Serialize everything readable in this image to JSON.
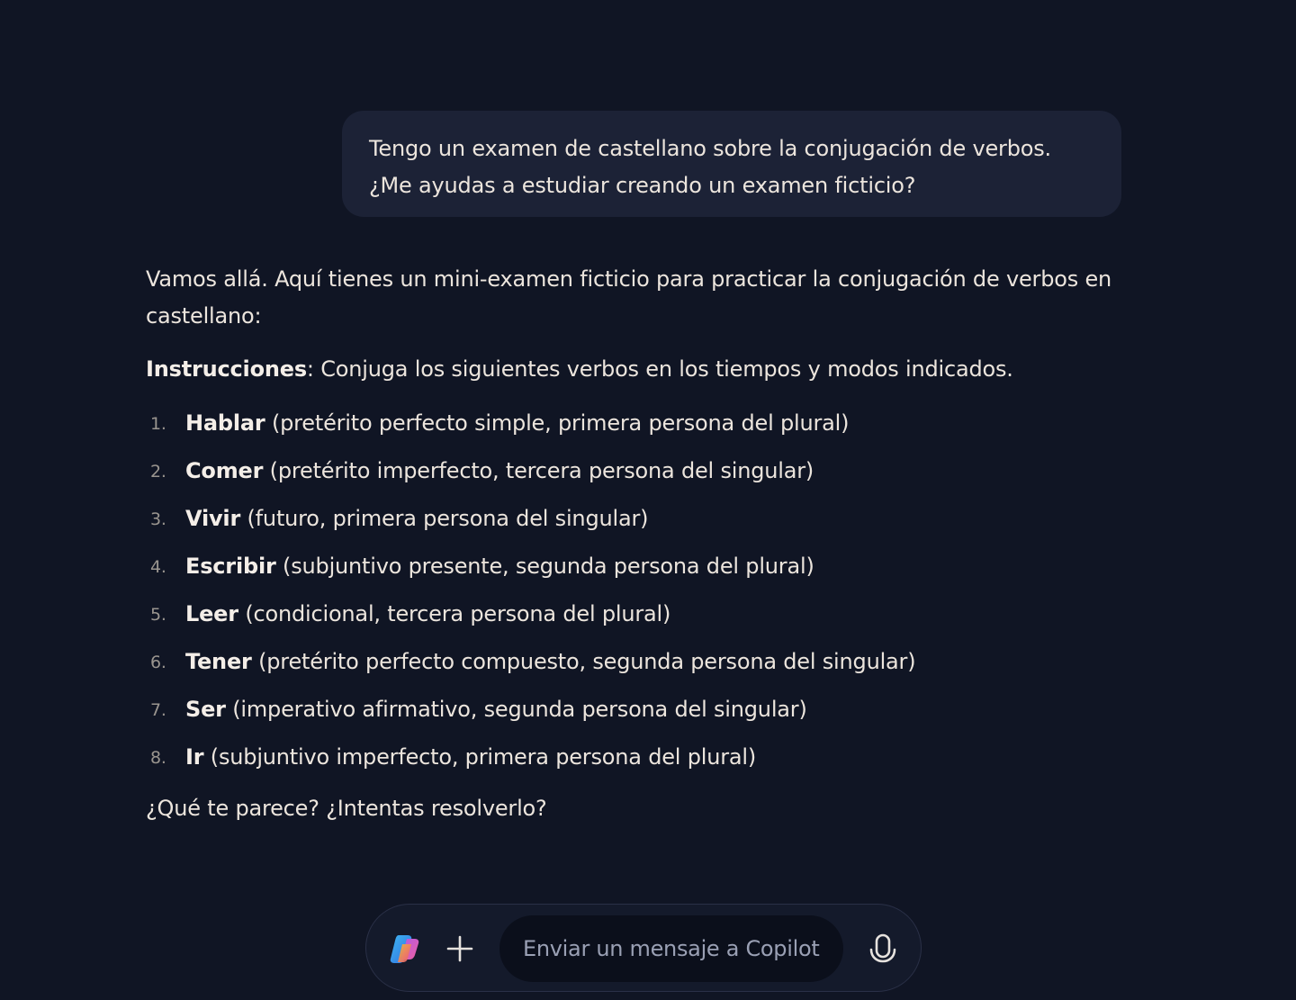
{
  "user_message": {
    "lines": [
      "Tengo un examen de castellano sobre la conjugación de verbos.",
      "¿Me ayudas a estudiar creando un examen ficticio?"
    ]
  },
  "assistant_message": {
    "intro_lines": [
      "Vamos allá. Aquí tienes un mini-examen ficticio para practicar la conjugación de verbos en",
      "castellano:"
    ],
    "instructions_label": "Instrucciones",
    "instructions_text": ": Conjuga los siguientes verbos en los tiempos y modos indicados.",
    "items": [
      {
        "num": "1.",
        "verb": "Hablar",
        "detail": " (pretérito perfecto simple, primera persona del plural)"
      },
      {
        "num": "2.",
        "verb": "Comer",
        "detail": " (pretérito imperfecto, tercera persona del singular)"
      },
      {
        "num": "3.",
        "verb": "Vivir",
        "detail": " (futuro, primera persona del singular)"
      },
      {
        "num": "4.",
        "verb": "Escribir",
        "detail": " (subjuntivo presente, segunda persona del plural)"
      },
      {
        "num": "5.",
        "verb": "Leer",
        "detail": " (condicional, tercera persona del plural)"
      },
      {
        "num": "6.",
        "verb": "Tener",
        "detail": " (pretérito perfecto compuesto, segunda persona del singular)"
      },
      {
        "num": "7.",
        "verb": "Ser",
        "detail": " (imperativo afirmativo, segunda persona del singular)"
      },
      {
        "num": "8.",
        "verb": "Ir",
        "detail": " (subjuntivo imperfecto, primera persona del plural)"
      }
    ],
    "closing": "¿Qué te parece? ¿Intentas resolverlo?"
  },
  "composer": {
    "logo_icon": "copilot-logo-icon",
    "plus_icon": "plus-icon",
    "placeholder": "Enviar un mensaje a Copilot",
    "mic_icon": "microphone-icon"
  },
  "colors": {
    "background": "#101524",
    "user_bubble": "#1c2236",
    "text": "#ece5dd",
    "list_number": "#9a958f",
    "placeholder": "#9aa0b4"
  }
}
